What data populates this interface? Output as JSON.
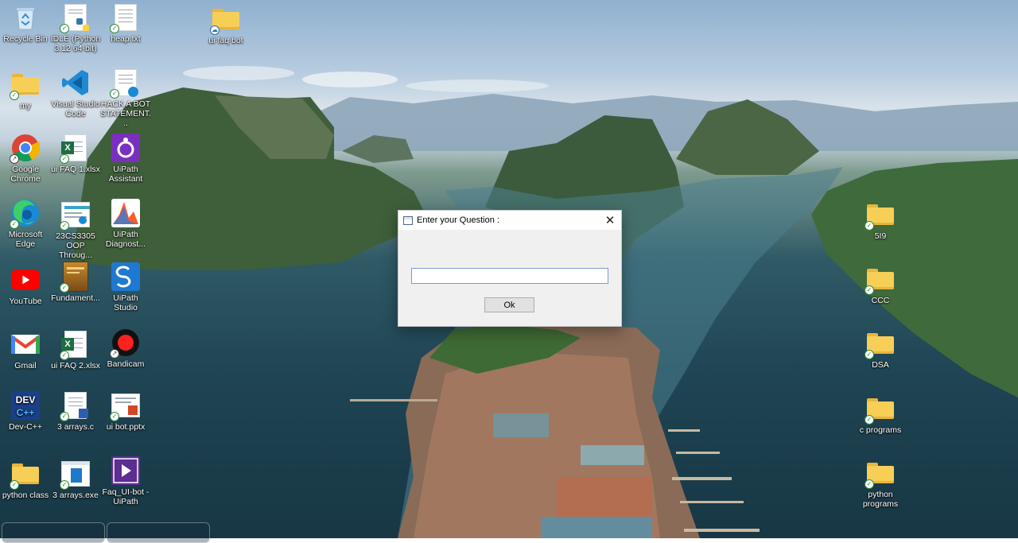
{
  "desktop": {
    "icons": [
      {
        "label": "Recycle Bin",
        "icon": "recycle-bin-icon"
      },
      {
        "label": "IDLE (Python 3.12 64-bit)",
        "icon": "python-idle-icon"
      },
      {
        "label": "heap.txt",
        "icon": "text-file-icon"
      },
      {
        "label": "ui faq bot",
        "icon": "folder-icon"
      },
      {
        "label": "my",
        "icon": "folder-icon"
      },
      {
        "label": "Visual Studio Code",
        "icon": "vscode-icon"
      },
      {
        "label": "HACK A BOT STATEMENT...",
        "icon": "edge-pdf-icon"
      },
      {
        "label": "Google Chrome",
        "icon": "chrome-icon"
      },
      {
        "label": "ui FAQ 1.xlsx",
        "icon": "excel-icon"
      },
      {
        "label": "UiPath Assistant",
        "icon": "uipath-assistant-icon"
      },
      {
        "label": "Microsoft Edge",
        "icon": "edge-icon"
      },
      {
        "label": "23CS3305 OOP Throug...",
        "icon": "document-thumbnail-icon"
      },
      {
        "label": "UiPath Diagnost...",
        "icon": "uipath-diagnostic-icon"
      },
      {
        "label": "YouTube",
        "icon": "youtube-icon"
      },
      {
        "label": "Fundament...",
        "icon": "book-icon"
      },
      {
        "label": "UiPath Studio",
        "icon": "uipath-studio-icon"
      },
      {
        "label": "Gmail",
        "icon": "gmail-icon"
      },
      {
        "label": "ui FAQ 2.xlsx",
        "icon": "excel-icon"
      },
      {
        "label": "Bandicam",
        "icon": "bandicam-icon"
      },
      {
        "label": "Dev-C++",
        "icon": "devcpp-icon"
      },
      {
        "label": "3 arrays.c",
        "icon": "c-file-icon"
      },
      {
        "label": "ui bot.pptx",
        "icon": "powerpoint-icon"
      },
      {
        "label": "python class",
        "icon": "folder-icon"
      },
      {
        "label": "3 arrays.exe",
        "icon": "exe-icon"
      },
      {
        "label": "Faq_UI-bot - UiPath",
        "icon": "uipath-project-icon"
      },
      {
        "label": "5I9",
        "icon": "folder-icon"
      },
      {
        "label": "CCC",
        "icon": "folder-icon"
      },
      {
        "label": "DSA",
        "icon": "folder-icon"
      },
      {
        "label": "c programs",
        "icon": "folder-icon"
      },
      {
        "label": "python programs",
        "icon": "folder-icon"
      }
    ]
  },
  "dialog": {
    "title": "Enter your Question :",
    "input_value": "",
    "ok_label": "Ok",
    "close_glyph": "✕"
  },
  "colors": {
    "folder": "#f7cf57",
    "input_border": "#7a9cc6",
    "sync_badge": "#2f8a3a"
  }
}
